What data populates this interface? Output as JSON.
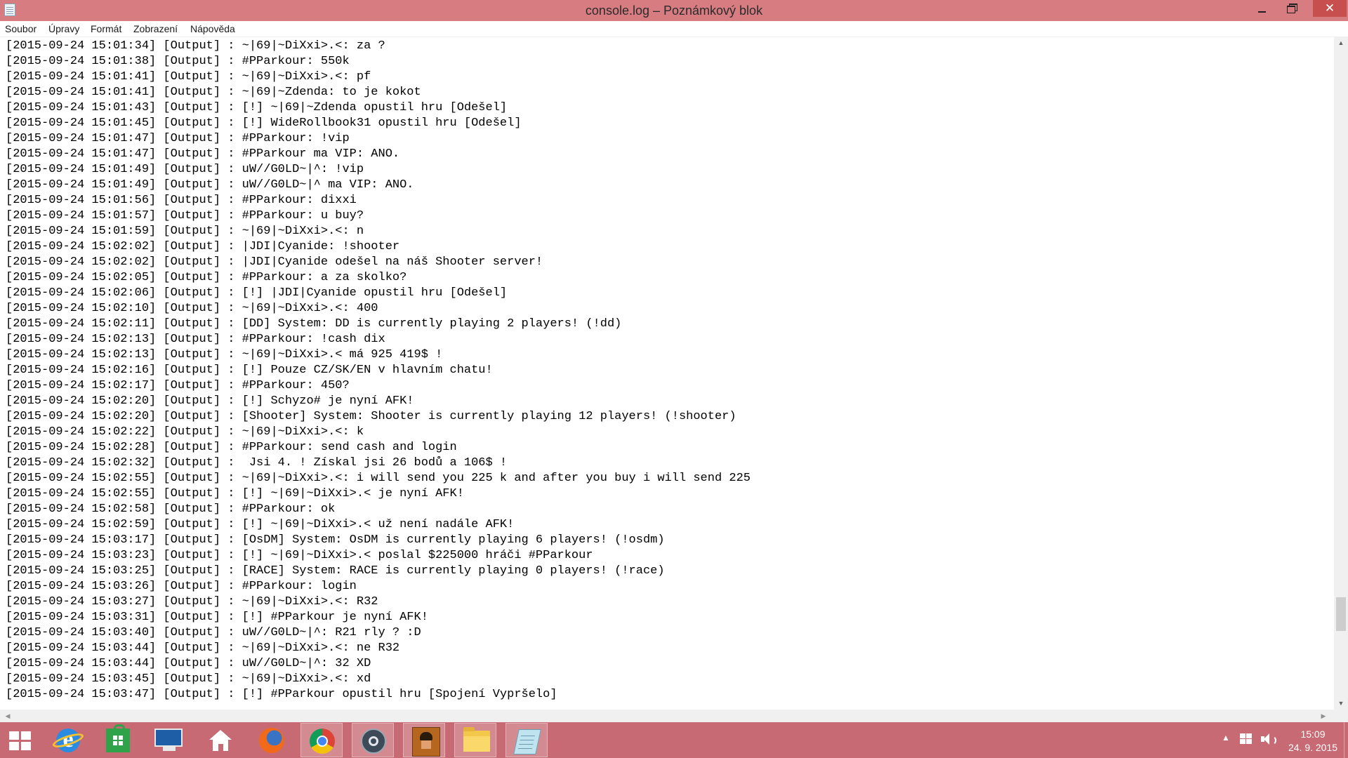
{
  "window": {
    "title": "console.log – Poznámkový blok",
    "close_glyph": "✕"
  },
  "menu": [
    "Soubor",
    "Úpravy",
    "Formát",
    "Zobrazení",
    "Nápověda"
  ],
  "log_lines": [
    "[2015-09-24 15:01:34] [Output] : ~|69|~DiXxi>.<: za ?",
    "[2015-09-24 15:01:38] [Output] : #PParkour: 550k",
    "[2015-09-24 15:01:41] [Output] : ~|69|~DiXxi>.<: pf",
    "[2015-09-24 15:01:41] [Output] : ~|69|~Zdenda: to je kokot",
    "[2015-09-24 15:01:43] [Output] : [!] ~|69|~Zdenda opustil hru [Odešel]",
    "[2015-09-24 15:01:45] [Output] : [!] WideRollbook31 opustil hru [Odešel]",
    "[2015-09-24 15:01:47] [Output] : #PParkour: !vip",
    "[2015-09-24 15:01:47] [Output] : #PParkour ma VIP: ANO.",
    "[2015-09-24 15:01:49] [Output] : uW//G0LD~|^: !vip",
    "[2015-09-24 15:01:49] [Output] : uW//G0LD~|^ ma VIP: ANO.",
    "[2015-09-24 15:01:56] [Output] : #PParkour: dixxi",
    "[2015-09-24 15:01:57] [Output] : #PParkour: u buy?",
    "[2015-09-24 15:01:59] [Output] : ~|69|~DiXxi>.<: n",
    "[2015-09-24 15:02:02] [Output] : |JDI|Cyanide: !shooter",
    "[2015-09-24 15:02:02] [Output] : |JDI|Cyanide odešel na náš Shooter server!",
    "[2015-09-24 15:02:05] [Output] : #PParkour: a za skolko?",
    "[2015-09-24 15:02:06] [Output] : [!] |JDI|Cyanide opustil hru [Odešel]",
    "[2015-09-24 15:02:10] [Output] : ~|69|~DiXxi>.<: 400",
    "[2015-09-24 15:02:11] [Output] : [DD] System: DD is currently playing 2 players! (!dd)",
    "[2015-09-24 15:02:13] [Output] : #PParkour: !cash dix",
    "[2015-09-24 15:02:13] [Output] : ~|69|~DiXxi>.< má 925 419$ !",
    "[2015-09-24 15:02:16] [Output] : [!] Pouze CZ/SK/EN v hlavním chatu!",
    "[2015-09-24 15:02:17] [Output] : #PParkour: 450?",
    "[2015-09-24 15:02:20] [Output] : [!] Schyzo# je nyní AFK!",
    "[2015-09-24 15:02:20] [Output] : [Shooter] System: Shooter is currently playing 12 players! (!shooter)",
    "[2015-09-24 15:02:22] [Output] : ~|69|~DiXxi>.<: k",
    "[2015-09-24 15:02:28] [Output] : #PParkour: send cash and login",
    "[2015-09-24 15:02:32] [Output] :  Jsi 4. ! Získal jsi 26 bodů a 106$ !",
    "[2015-09-24 15:02:55] [Output] : ~|69|~DiXxi>.<: i will send you 225 k and after you buy i will send 225",
    "[2015-09-24 15:02:55] [Output] : [!] ~|69|~DiXxi>.< je nyní AFK!",
    "[2015-09-24 15:02:58] [Output] : #PParkour: ok",
    "[2015-09-24 15:02:59] [Output] : [!] ~|69|~DiXxi>.< už není nadále AFK!",
    "[2015-09-24 15:03:17] [Output] : [OsDM] System: OsDM is currently playing 6 players! (!osdm)",
    "[2015-09-24 15:03:23] [Output] : [!] ~|69|~DiXxi>.< poslal $225000 hráči #PParkour",
    "[2015-09-24 15:03:25] [Output] : [RACE] System: RACE is currently playing 0 players! (!race)",
    "[2015-09-24 15:03:26] [Output] : #PParkour: login",
    "[2015-09-24 15:03:27] [Output] : ~|69|~DiXxi>.<: R32",
    "[2015-09-24 15:03:31] [Output] : [!] #PParkour je nyní AFK!",
    "[2015-09-24 15:03:40] [Output] : uW//G0LD~|^: R21 rly ? :D",
    "[2015-09-24 15:03:44] [Output] : ~|69|~DiXxi>.<: ne R32",
    "[2015-09-24 15:03:44] [Output] : uW//G0LD~|^: 32 XD",
    "[2015-09-24 15:03:45] [Output] : ~|69|~DiXxi>.<: xd",
    "[2015-09-24 15:03:47] [Output] : [!] #PParkour opustil hru [Spojení Vypršelo]"
  ],
  "scrollbars": {
    "up": "▲",
    "down": "▼",
    "left": "◀",
    "right": "▶"
  },
  "taskbar": {
    "apps": [
      {
        "name": "start-button",
        "icon": "windows-logo-icon"
      },
      {
        "name": "internet-explorer",
        "icon": "internet-explorer-icon",
        "glyph": "e"
      },
      {
        "name": "windows-store",
        "icon": "store-icon"
      },
      {
        "name": "lenovo-app",
        "icon": "monitor-icon"
      },
      {
        "name": "home",
        "icon": "home-icon"
      },
      {
        "name": "firefox",
        "icon": "firefox-icon"
      },
      {
        "name": "chrome",
        "icon": "chrome-icon"
      },
      {
        "name": "steam",
        "icon": "steam-icon"
      },
      {
        "name": "game",
        "icon": "game-character-icon"
      },
      {
        "name": "file-explorer",
        "icon": "folder-icon"
      },
      {
        "name": "notepad",
        "icon": "notepad-icon"
      }
    ],
    "tray_chevron": "▲",
    "clock_time": "15:09",
    "clock_date": "24. 9. 2015"
  },
  "colors": {
    "titlebar": "#d77c80",
    "close_button": "#c7504f",
    "taskbar": "#c86a73"
  }
}
